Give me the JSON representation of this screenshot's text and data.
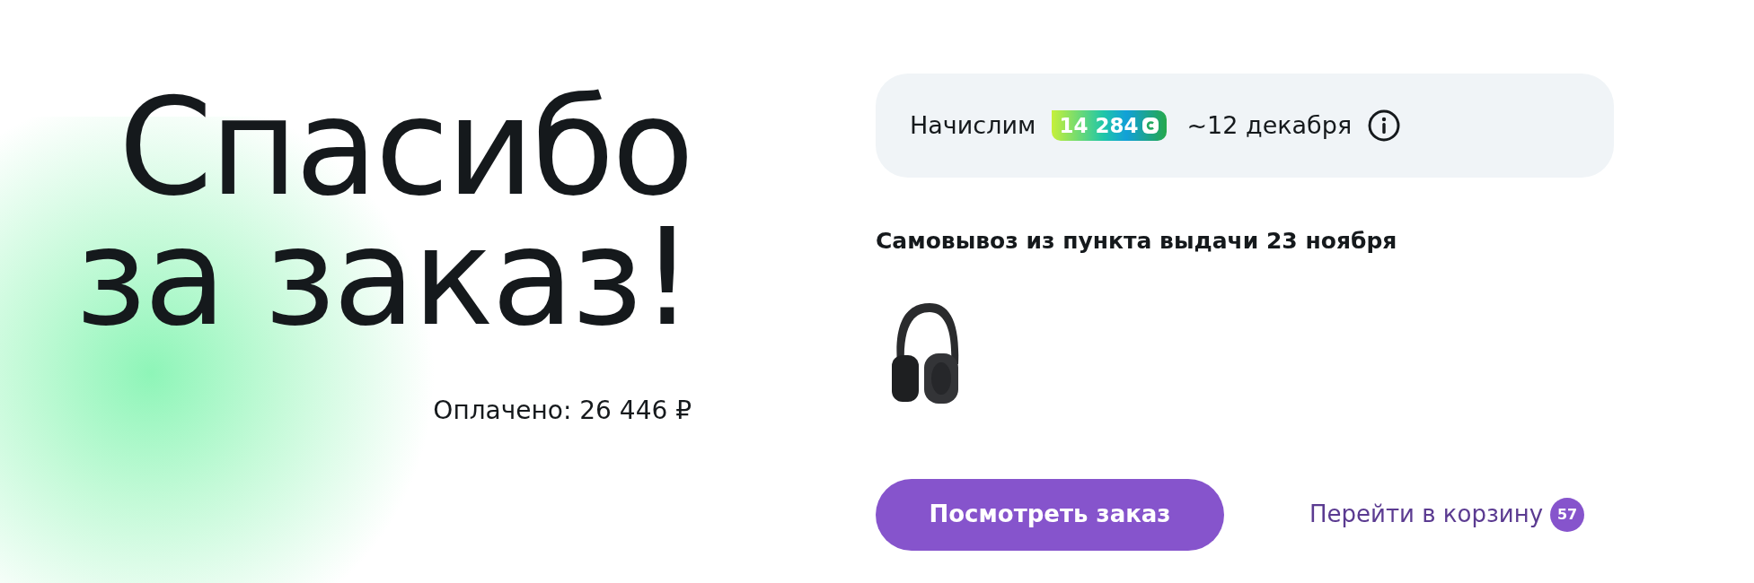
{
  "heading": {
    "line_1": "Спасибо",
    "line_2": "за заказ!"
  },
  "paid": "Оплачено: 26 446 ₽",
  "bonus": {
    "label": "Начислим",
    "amount": "14 284",
    "date": "~12 декабря"
  },
  "delivery": {
    "title": "Самовывоз из пункта выдачи 23 ноября"
  },
  "actions": {
    "view_order": "Посмотреть заказ",
    "cart_link": "Перейти в корзину",
    "cart_count": "57"
  }
}
